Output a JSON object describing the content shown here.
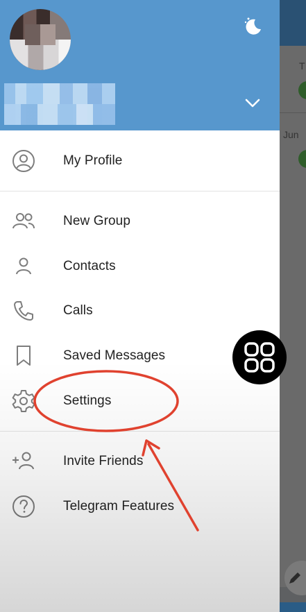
{
  "header": {
    "night_mode_icon": "moon-stars-icon",
    "expand_icon": "chevron-down-icon",
    "accent_color": "#5797cd"
  },
  "menu": {
    "my_profile": "My Profile",
    "new_group": "New Group",
    "contacts": "Contacts",
    "calls": "Calls",
    "saved_messages": "Saved Messages",
    "settings": "Settings",
    "invite_friends": "Invite Friends",
    "telegram_features": "Telegram Features"
  },
  "background": {
    "row1_text": "T",
    "row2_text": "Jun"
  },
  "annotation": {
    "circle_color": "#e0422f",
    "target": "Settings"
  }
}
